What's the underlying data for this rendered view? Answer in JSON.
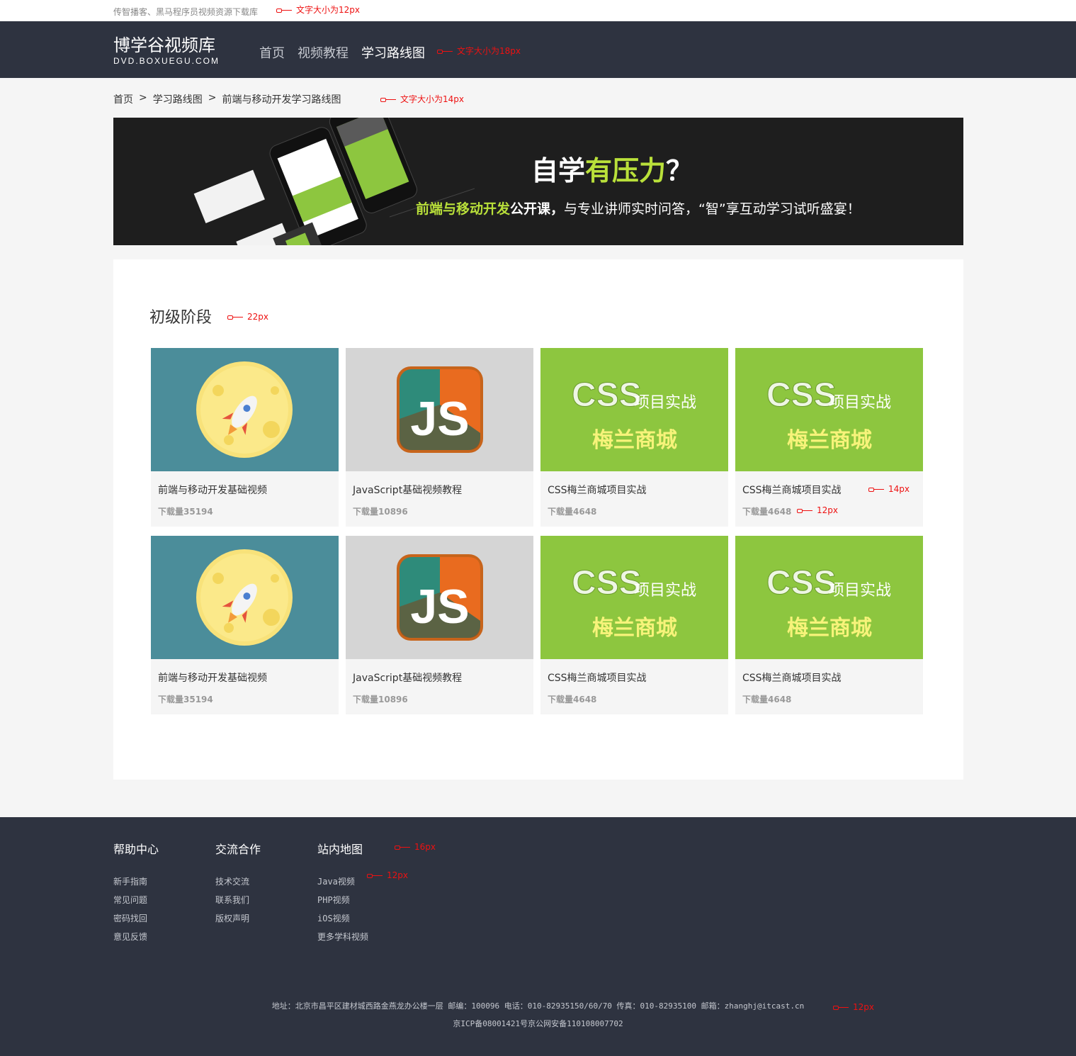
{
  "topbar": {
    "tagline": "传智播客、黑马程序员视频资源下载库"
  },
  "header": {
    "logo_title": "博学谷视频库",
    "logo_sub": "DVD.BOXUEGU.COM",
    "nav": [
      "首页",
      "视频教程",
      "学习路线图"
    ]
  },
  "breadcrumb": [
    "首页",
    "学习路线图",
    "前端与移动开发学习路线图"
  ],
  "banner": {
    "title_pre": "自学",
    "title_hl": "有压力",
    "title_post": "？",
    "line_hl": "前端与移动开发",
    "line_bold": "公开课，",
    "line_rest": "与专业讲师实时问答，“智”享互动学习试听盛宴！"
  },
  "stage": {
    "title": "初级阶段"
  },
  "cards": [
    {
      "name": "前端与移动开发基础视频",
      "downloads": "下载量35194",
      "thumb": "rocket"
    },
    {
      "name": "JavaScript基础视频教程",
      "downloads": "下载量10896",
      "thumb": "js"
    },
    {
      "name": "CSS梅兰商城项目实战",
      "downloads": "下载量4648",
      "thumb": "css"
    },
    {
      "name": "CSS梅兰商城项目实战",
      "downloads": "下载量4648",
      "thumb": "css"
    },
    {
      "name": "前端与移动开发基础视频",
      "downloads": "下载量35194",
      "thumb": "rocket"
    },
    {
      "name": "JavaScript基础视频教程",
      "downloads": "下载量10896",
      "thumb": "js"
    },
    {
      "name": "CSS梅兰商城项目实战",
      "downloads": "下载量4648",
      "thumb": "css"
    },
    {
      "name": "CSS梅兰商城项目实战",
      "downloads": "下载量4648",
      "thumb": "css"
    }
  ],
  "thumb_text": {
    "js": "JS",
    "css": "CSS",
    "css_sub": "项目实战",
    "css_main": "梅兰商城"
  },
  "footer": {
    "columns": [
      {
        "title": "帮助中心",
        "links": [
          "新手指南",
          "常见问题",
          "密码找回",
          "意见反馈"
        ]
      },
      {
        "title": "交流合作",
        "links": [
          "技术交流",
          "联系我们",
          "版权声明"
        ]
      },
      {
        "title": "站内地图",
        "links": [
          "Java视频",
          "PHP视频",
          "iOS视频",
          "更多学科视频"
        ]
      }
    ],
    "address": "地址：北京市昌平区建材城西路金燕龙办公楼一层 邮编：100096 电话：010-82935150/60/70 传真：010-82935100 邮箱：zhanghj@itcast.cn",
    "icp": "京ICP备08001421号京公网安备110108007702"
  },
  "annotations": {
    "a1": "文字大小为12px",
    "a2": "文字大小为18px",
    "a3": "文字大小为14px",
    "a4": "22px",
    "a5": "14px",
    "a6": "12px",
    "a7": "16px",
    "a8": "12px",
    "a9": "12px"
  },
  "colors": {
    "header_bg": "#2e3340",
    "accent_green": "#b9e03a",
    "thumb_teal": "#4b8d9a",
    "thumb_green": "#8dc63f",
    "annotation": "#e11111"
  }
}
